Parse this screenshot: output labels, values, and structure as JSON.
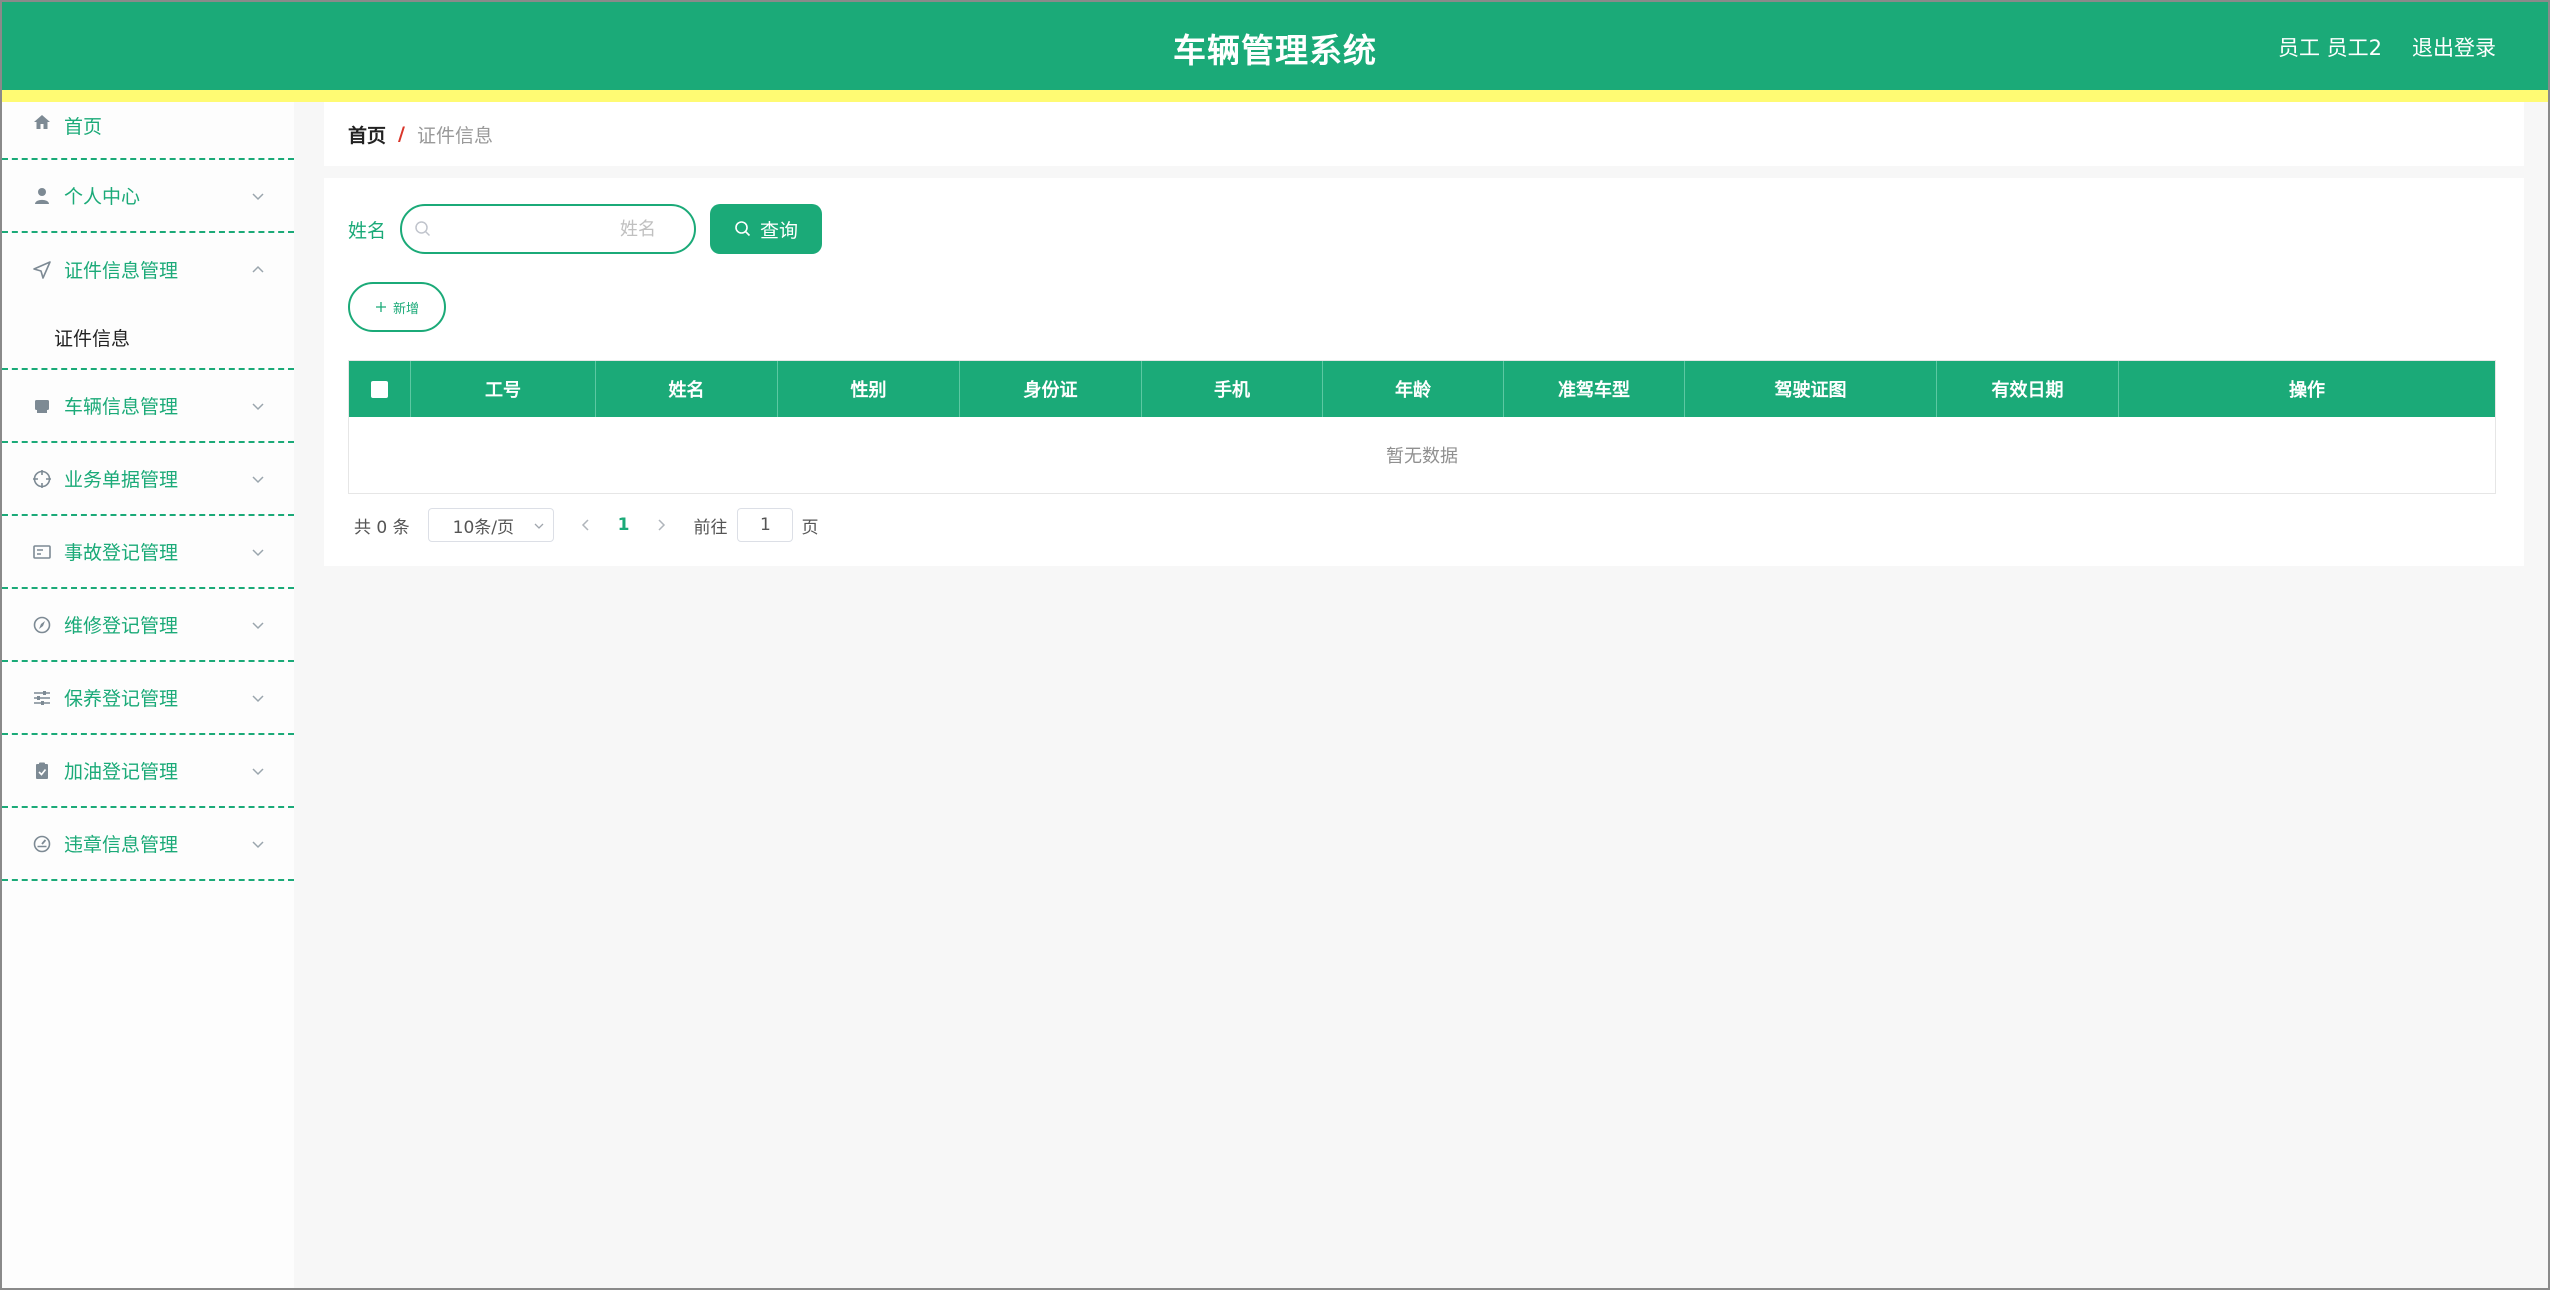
{
  "header": {
    "title": "车辆管理系统",
    "user_label": "员工 员工2",
    "logout_label": "退出登录",
    "bg_color": "#1baa78",
    "accent_color": "#fffb73"
  },
  "sidebar": {
    "items": [
      {
        "label": "首页",
        "icon": "home-icon"
      },
      {
        "label": "个人中心",
        "icon": "user-icon"
      },
      {
        "label": "证件信息管理",
        "icon": "send-icon",
        "expanded": true,
        "children": [
          {
            "label": "证件信息"
          }
        ]
      },
      {
        "label": "车辆信息管理",
        "icon": "printer-icon"
      },
      {
        "label": "业务单据管理",
        "icon": "target-icon"
      },
      {
        "label": "事故登记管理",
        "icon": "id-card-icon"
      },
      {
        "label": "维修登记管理",
        "icon": "compass-icon"
      },
      {
        "label": "保养登记管理",
        "icon": "sliders-icon"
      },
      {
        "label": "加油登记管理",
        "icon": "clipboard-icon"
      },
      {
        "label": "违章信息管理",
        "icon": "gauge-icon"
      }
    ]
  },
  "breadcrumb": {
    "home": "首页",
    "separator": "/",
    "current": "证件信息"
  },
  "search": {
    "label": "姓名",
    "placeholder": "姓名",
    "value": "",
    "button_label": "查询"
  },
  "toolbar": {
    "add_label": "新增"
  },
  "table": {
    "columns": [
      "工号",
      "姓名",
      "性别",
      "身份证",
      "手机",
      "年龄",
      "准驾车型",
      "驾驶证图",
      "有效日期",
      "操作"
    ],
    "empty_text": "暂无数据",
    "rows": []
  },
  "pagination": {
    "total_text": "共 0 条",
    "page_size": "10条/页",
    "current_page": "1",
    "goto_prefix": "前往",
    "goto_value": "1",
    "goto_suffix": "页"
  }
}
